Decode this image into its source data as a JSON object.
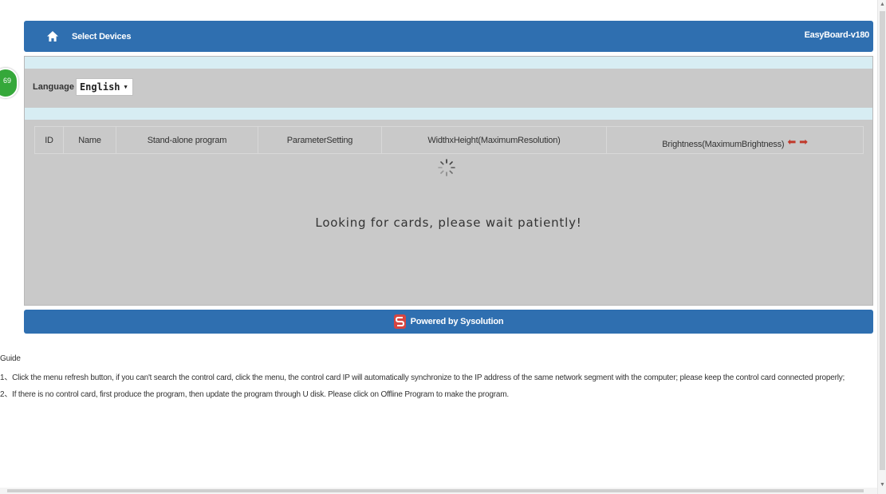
{
  "header": {
    "title": "Select Devices",
    "version": "EasyBoard-v180",
    "home_icon": "home-icon"
  },
  "badge": {
    "text": "69"
  },
  "language": {
    "label": "Language",
    "selected": "English"
  },
  "table": {
    "columns": [
      "ID",
      "Name",
      "Stand-alone program",
      "ParameterSetting",
      "WidthxHeight(MaximumResolution)",
      "Brightness(MaximumBrightness)"
    ],
    "arrow_left": "⬅",
    "arrow_right": "➡"
  },
  "status": {
    "message": "Looking for cards, please wait patiently!"
  },
  "footer": {
    "text": "Powered by Sysolution"
  },
  "guide": {
    "title": "Guide",
    "items": [
      "1、Click the menu refresh button, if you can't search the control card, click the menu, the control card IP will automatically synchronize to the IP address of the same network segment with the computer; please keep the control card connected properly;",
      "2、If there is no control card, first produce the program, then update the program through U disk. Please click on Offline Program to make the program."
    ]
  },
  "colors": {
    "bar_blue": "#2f6fb0",
    "panel_gray": "#c9c9c9",
    "strip_blue": "#d7edf3",
    "arrow_red": "#c0392b",
    "badge_green": "#35a83a"
  }
}
